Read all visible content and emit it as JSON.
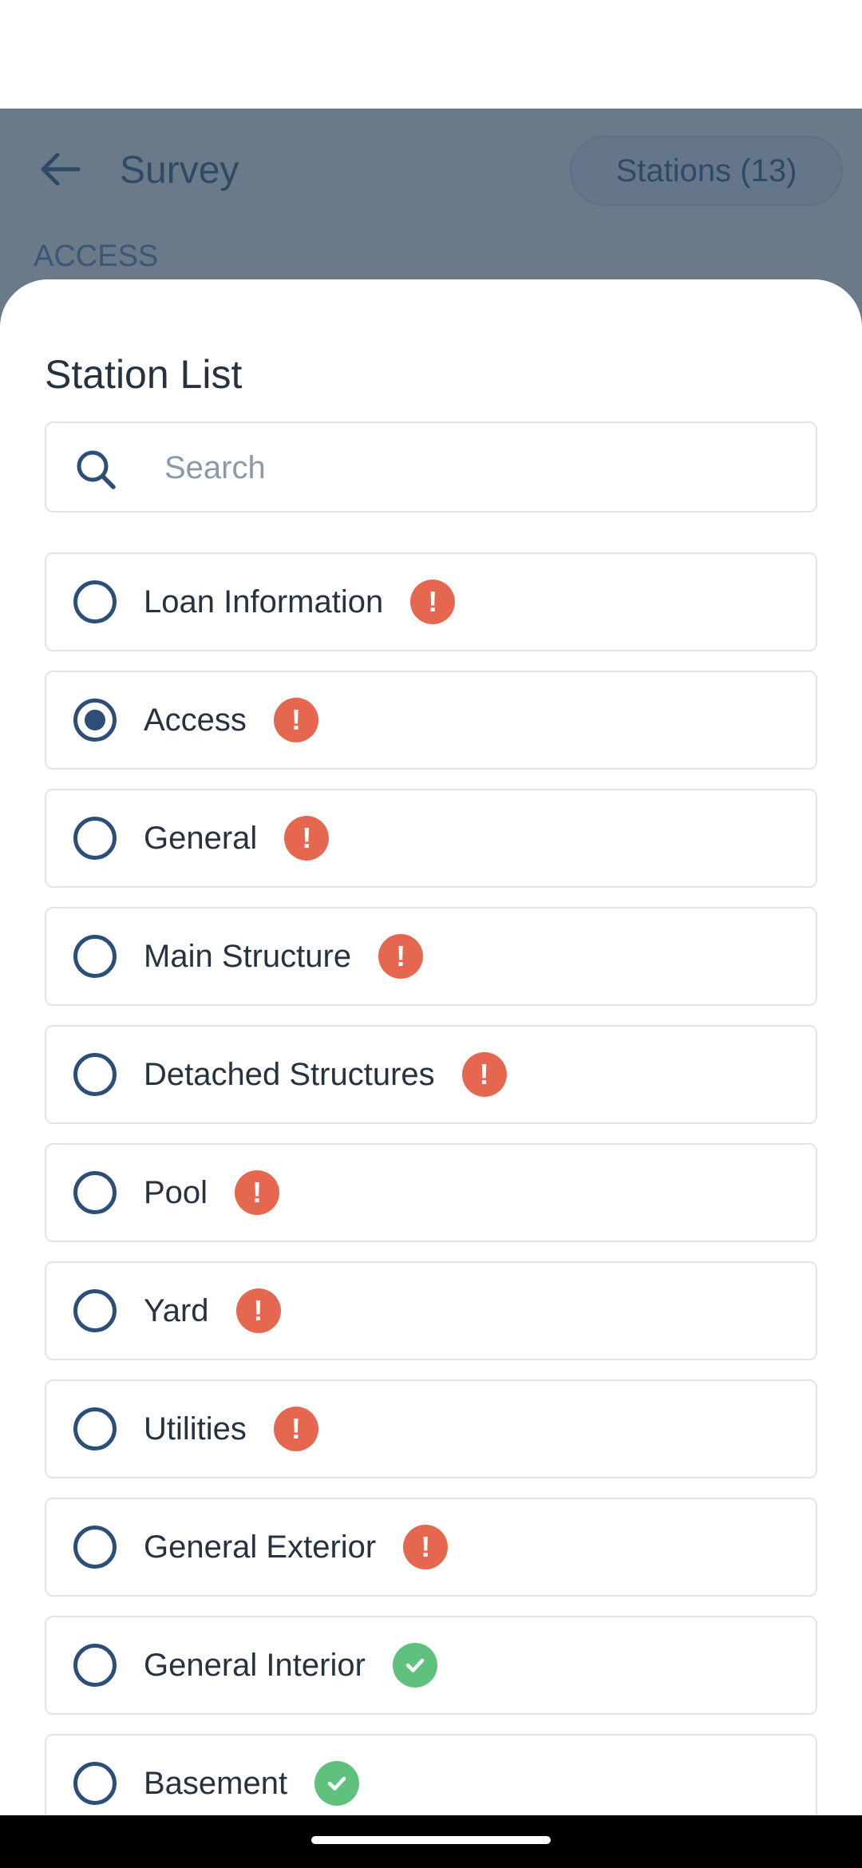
{
  "header": {
    "title": "Survey",
    "stations_label": "Stations (13)",
    "section": "ACCESS"
  },
  "sheet": {
    "title": "Station List",
    "search_placeholder": "Search"
  },
  "stations": [
    {
      "label": "Loan Information",
      "status": "error",
      "selected": false
    },
    {
      "label": "Access",
      "status": "error",
      "selected": true
    },
    {
      "label": "General",
      "status": "error",
      "selected": false
    },
    {
      "label": "Main Structure",
      "status": "error",
      "selected": false
    },
    {
      "label": "Detached Structures",
      "status": "error",
      "selected": false
    },
    {
      "label": "Pool",
      "status": "error",
      "selected": false
    },
    {
      "label": "Yard",
      "status": "error",
      "selected": false
    },
    {
      "label": "Utilities",
      "status": "error",
      "selected": false
    },
    {
      "label": "General Exterior",
      "status": "error",
      "selected": false
    },
    {
      "label": "General Interior",
      "status": "complete",
      "selected": false
    },
    {
      "label": "Basement",
      "status": "complete",
      "selected": false
    }
  ],
  "icons": {
    "error": "exclamation-icon",
    "complete": "check-icon"
  },
  "colors": {
    "error": "#e5674f",
    "complete": "#5fc17d",
    "accent": "#2c4e77",
    "header_overlay": "#6b7a88"
  }
}
